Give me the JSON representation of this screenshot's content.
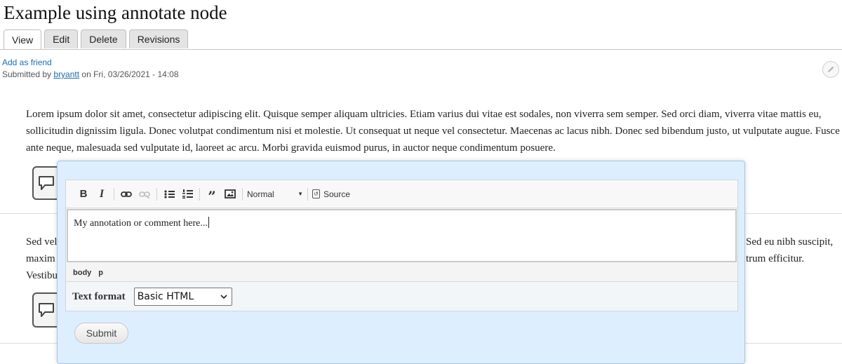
{
  "page": {
    "title": "Example using annotate node",
    "tabs": [
      "View",
      "Edit",
      "Delete",
      "Revisions"
    ],
    "active_tab": "View"
  },
  "meta": {
    "add_friend": "Add as friend",
    "submitted_prefix": "Submitted by",
    "author": "bryantt",
    "submitted_suffix": "on Fri, 03/26/2021 - 14:08"
  },
  "content": {
    "paragraph1": "Lorem ipsum dolor sit amet, consectetur adipiscing elit. Quisque semper aliquam ultricies. Etiam varius dui vitae est sodales, non viverra sem semper. Sed orci diam, viverra vitae mattis eu, sollicitudin dignissim ligula. Donec volutpat condimentum nisi et molestie. Ut consequat ut neque vel consectetur. Maecenas ac lacus nibh. Donec sed bibendum justo, ut vulputate augue. Fusce ante neque, malesuada sed vulputate id, laoreet ac arcu. Morbi gravida euismod purus, in auctor neque condimentum posuere.",
    "paragraph2_left": [
      "Sed vel",
      "maxim",
      "Vestibu"
    ],
    "paragraph2_right": [
      "Sed eu nibh suscipit,",
      "trum efficitur.",
      ""
    ]
  },
  "editor": {
    "toolbar": {
      "bold": "B",
      "italic": "I",
      "format_value": "Normal",
      "source_label": "Source"
    },
    "icons": [
      "bold-icon",
      "italic-icon",
      "link-icon",
      "unlink-icon",
      "bulleted-list-icon",
      "numbered-list-icon",
      "blockquote-icon",
      "image-icon",
      "source-icon"
    ],
    "body_text": "My annotation or comment here...",
    "path": [
      "body",
      "p"
    ],
    "text_format_label": "Text format",
    "text_format_value": "Basic HTML",
    "submit_label": "Submit"
  },
  "colors": {
    "link": "#1a6fb0",
    "popup_background": "#ddeeff",
    "popup_border": "#a8c7e6"
  }
}
